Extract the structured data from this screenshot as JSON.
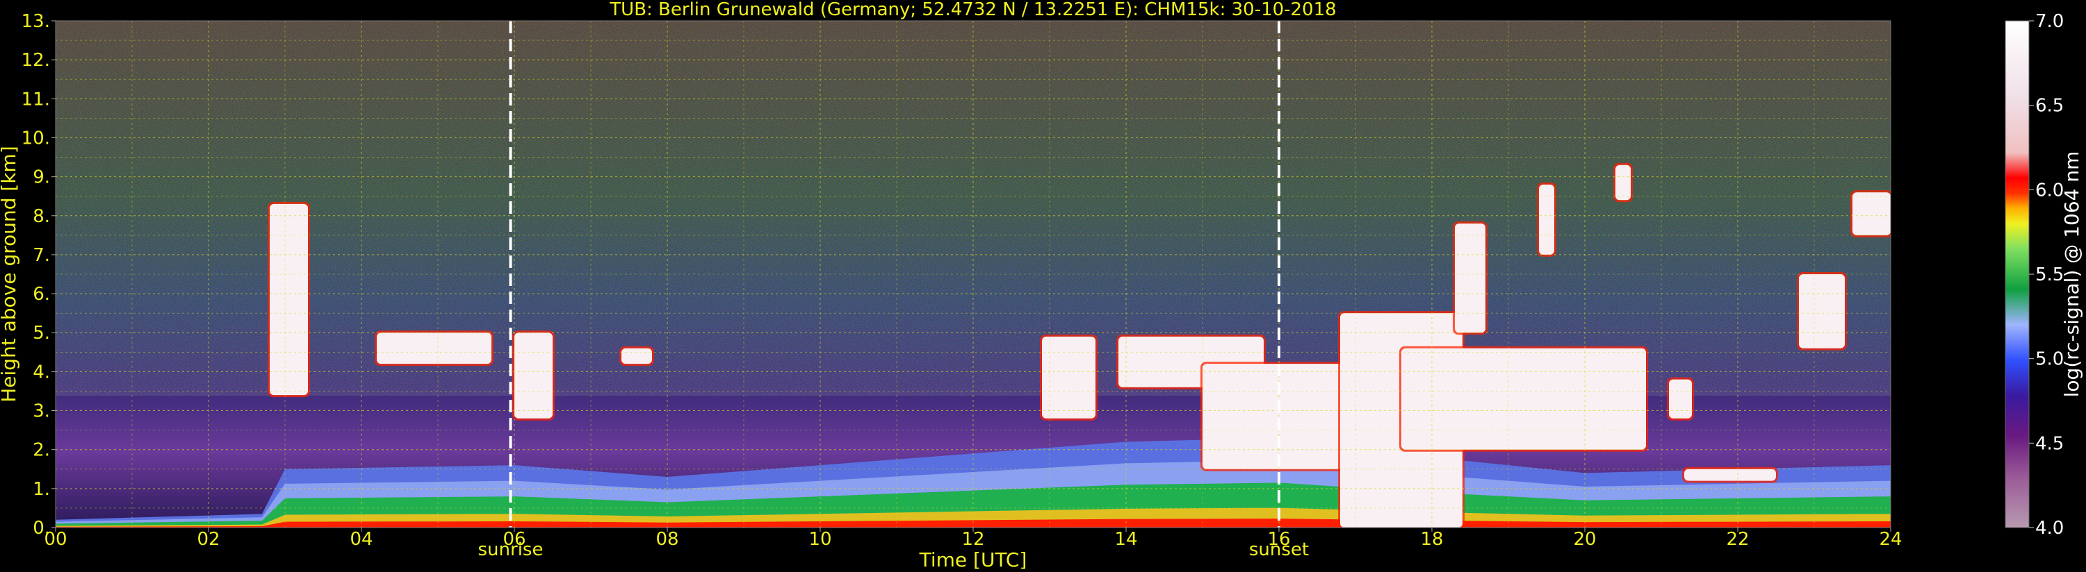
{
  "chart_data": {
    "type": "heatmap",
    "title": "TUB: Berlin Grunewald (Germany; 52.4732 N / 13.2251 E):    CHM15k: 30-10-2018",
    "xlabel": "Time [UTC]",
    "ylabel": "Height above ground [km]",
    "xlim": [
      0,
      24
    ],
    "ylim": [
      0,
      13
    ],
    "x_ticks": [
      "00",
      "02",
      "04",
      "06",
      "08",
      "10",
      "12",
      "14",
      "16",
      "18",
      "20",
      "22",
      "24"
    ],
    "y_ticks": [
      "0.",
      "1.",
      "2.",
      "3.",
      "4.",
      "5.",
      "6.",
      "7.",
      "8.",
      "9.",
      "10.",
      "11.",
      "12.",
      "13."
    ],
    "grid": true,
    "colorbar": {
      "label": "log(rc-signal) @ 1064 nm",
      "range": [
        4.0,
        7.0
      ],
      "ticks": [
        "4.0",
        "4.5",
        "5.0",
        "5.5",
        "6.0",
        "6.5",
        "7.0"
      ]
    },
    "markers": [
      {
        "label": "sunrise",
        "x": 5.95
      },
      {
        "label": "sunset",
        "x": 16.0
      }
    ],
    "features": {
      "boundary_layer": [
        {
          "x": 0,
          "top": 0.2
        },
        {
          "x": 2.7,
          "top": 0.35
        },
        {
          "x": 3,
          "top": 1.5
        },
        {
          "x": 6,
          "top": 1.6
        },
        {
          "x": 8,
          "top": 1.3
        },
        {
          "x": 10,
          "top": 1.6
        },
        {
          "x": 12,
          "top": 1.9
        },
        {
          "x": 14,
          "top": 2.2
        },
        {
          "x": 16,
          "top": 2.3
        },
        {
          "x": 18,
          "top": 1.8
        },
        {
          "x": 20,
          "top": 1.4
        },
        {
          "x": 22,
          "top": 1.5
        },
        {
          "x": 24,
          "top": 1.6
        }
      ],
      "clouds": [
        {
          "x0": 2.8,
          "x1": 3.3,
          "y0": 3.4,
          "y1": 8.3
        },
        {
          "x0": 4.2,
          "x1": 5.7,
          "y0": 4.2,
          "y1": 5.0
        },
        {
          "x0": 6.0,
          "x1": 6.5,
          "y0": 2.8,
          "y1": 5.0
        },
        {
          "x0": 7.4,
          "x1": 7.8,
          "y0": 4.2,
          "y1": 4.6
        },
        {
          "x0": 12.9,
          "x1": 13.6,
          "y0": 2.8,
          "y1": 4.9
        },
        {
          "x0": 13.9,
          "x1": 15.8,
          "y0": 3.6,
          "y1": 4.9
        },
        {
          "x0": 15.0,
          "x1": 17.0,
          "y0": 1.5,
          "y1": 4.2
        },
        {
          "x0": 16.8,
          "x1": 18.4,
          "y0": 0.0,
          "y1": 5.5
        },
        {
          "x0": 17.6,
          "x1": 20.8,
          "y0": 2.0,
          "y1": 4.6
        },
        {
          "x0": 18.3,
          "x1": 18.7,
          "y0": 5.0,
          "y1": 7.8
        },
        {
          "x0": 19.4,
          "x1": 19.6,
          "y0": 7.0,
          "y1": 8.8
        },
        {
          "x0": 20.4,
          "x1": 20.6,
          "y0": 8.4,
          "y1": 9.3
        },
        {
          "x0": 21.1,
          "x1": 21.4,
          "y0": 2.8,
          "y1": 3.8
        },
        {
          "x0": 21.3,
          "x1": 22.5,
          "y0": 1.2,
          "y1": 1.5
        },
        {
          "x0": 22.8,
          "x1": 23.4,
          "y0": 4.6,
          "y1": 6.5
        },
        {
          "x0": 23.5,
          "x1": 24.0,
          "y0": 7.5,
          "y1": 8.6
        }
      ]
    }
  }
}
